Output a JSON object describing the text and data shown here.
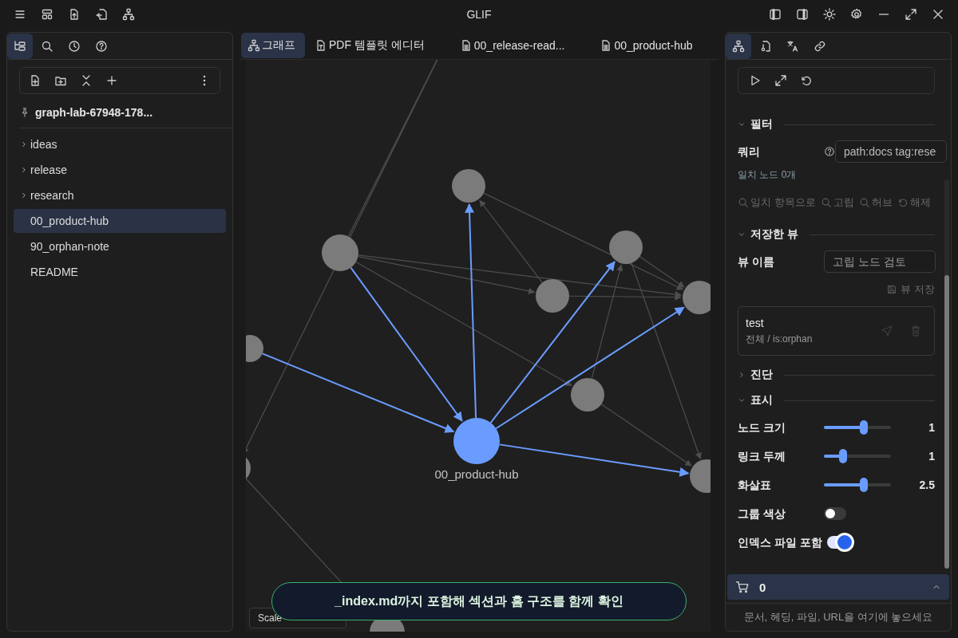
{
  "window": {
    "title": "GLIF"
  },
  "sidebar": {
    "tabs": [
      {
        "selected": true
      },
      {
        "selected": false
      },
      {
        "selected": false
      },
      {
        "selected": false
      }
    ],
    "vault": "graph-lab-67948-178...",
    "tree": [
      {
        "label": "ideas",
        "kind": "folder",
        "expanded": false,
        "selected": false
      },
      {
        "label": "release",
        "kind": "folder",
        "expanded": false,
        "selected": false
      },
      {
        "label": "research",
        "kind": "folder",
        "expanded": false,
        "selected": false
      },
      {
        "label": "00_product-hub",
        "kind": "file",
        "selected": true
      },
      {
        "label": "90_orphan-note",
        "kind": "file",
        "selected": false
      },
      {
        "label": "README",
        "kind": "file",
        "selected": false
      }
    ]
  },
  "editor_tabs": [
    {
      "label": "그래프",
      "kind": "graph",
      "selected": true
    },
    {
      "label": "PDF 템플릿 에디터",
      "kind": "template",
      "selected": false
    },
    {
      "label": "00_release-read...",
      "kind": "doc",
      "selected": false
    },
    {
      "label": "00_product-hub",
      "kind": "doc",
      "selected": false
    }
  ],
  "graph": {
    "hub_label": "00_product-hub",
    "scale_label": "Scale"
  },
  "toast": "_index.md까지 포함해 섹션과 홈 구조를 함께 확인",
  "inspector": {
    "tabs": [
      {
        "selected": true
      },
      {
        "selected": false
      },
      {
        "selected": false
      },
      {
        "selected": false
      }
    ],
    "filter": {
      "title": "필터",
      "expanded": true,
      "query_label": "쿼리",
      "query_value": "path:docs tag:rese",
      "match": "일치 노드 0개",
      "actions": [
        {
          "label": "일치 항목으로",
          "kind": "search",
          "disabled": true
        },
        {
          "label": "고립",
          "kind": "search",
          "disabled": true
        },
        {
          "label": "허브",
          "kind": "search",
          "disabled": true
        },
        {
          "label": "해제",
          "kind": "reset",
          "disabled": true
        }
      ]
    },
    "saved_views": {
      "title": "저장한 뷰",
      "expanded": true,
      "name_label": "뷰 이름",
      "name_placeholder": "고립 노드 검토",
      "save": {
        "label": "뷰 저장",
        "disabled": true
      },
      "views": [
        {
          "name": "test",
          "query": "전체 / is:orphan"
        }
      ]
    },
    "diagnostics": {
      "title": "진단",
      "expanded": false
    },
    "display": {
      "title": "표시",
      "expanded": true,
      "settings": [
        {
          "kind": "slider",
          "label": "노드 크기",
          "level": 0.6,
          "reading": "1"
        },
        {
          "kind": "slider",
          "label": "링크 두께",
          "level": 0.29,
          "reading": "1"
        },
        {
          "kind": "slider",
          "label": "화살표",
          "level": 0.6,
          "reading": "2.5"
        },
        {
          "kind": "toggle",
          "label": "그룹 색상",
          "on": false
        },
        {
          "kind": "toggle",
          "label": "인덱스 파일 포함",
          "on": true
        }
      ]
    },
    "cart": {
      "count": "0"
    },
    "dropzone": "문서, 헤딩, 파일, URL을 여기에 놓으세요"
  }
}
